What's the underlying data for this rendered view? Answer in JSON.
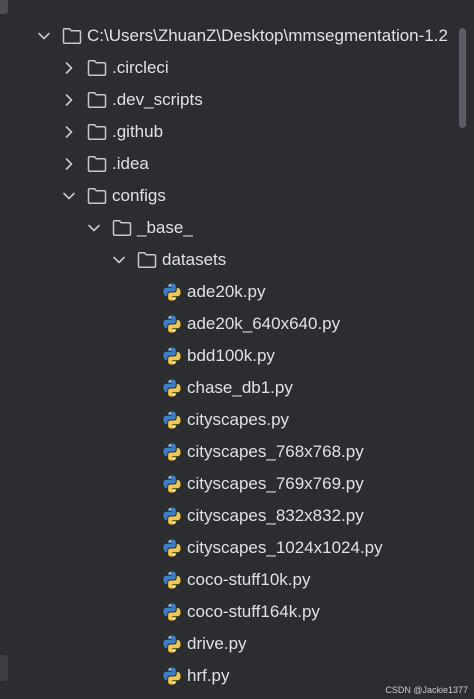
{
  "tree": {
    "root": {
      "label": "C:\\Users\\ZhuanZ\\Desktop\\mmsegmentation-1.2",
      "icon": "folder-icon",
      "expanded": true
    },
    "children": [
      {
        "label": ".circleci",
        "icon": "folder-icon",
        "expanded": false
      },
      {
        "label": ".dev_scripts",
        "icon": "folder-icon",
        "expanded": false
      },
      {
        "label": ".github",
        "icon": "folder-icon",
        "expanded": false
      },
      {
        "label": ".idea",
        "icon": "folder-icon",
        "expanded": false
      },
      {
        "label": "configs",
        "icon": "folder-icon",
        "expanded": true
      }
    ],
    "base": {
      "label": "_base_",
      "icon": "folder-icon",
      "expanded": true
    },
    "datasets": {
      "label": "datasets",
      "icon": "folder-icon",
      "expanded": true
    },
    "files": [
      "ade20k.py",
      "ade20k_640x640.py",
      "bdd100k.py",
      "chase_db1.py",
      "cityscapes.py",
      "cityscapes_768x768.py",
      "cityscapes_769x769.py",
      "cityscapes_832x832.py",
      "cityscapes_1024x1024.py",
      "coco-stuff10k.py",
      "coco-stuff164k.py",
      "drive.py",
      "hrf.py"
    ]
  },
  "watermark": "CSDN @Jackie1377",
  "colors": {
    "background": "#2b2d30",
    "text": "#dfe1e5",
    "folder_outline": "#c5c8ce",
    "python_blue": "#3f7fc4",
    "python_yellow": "#f2c94c"
  }
}
